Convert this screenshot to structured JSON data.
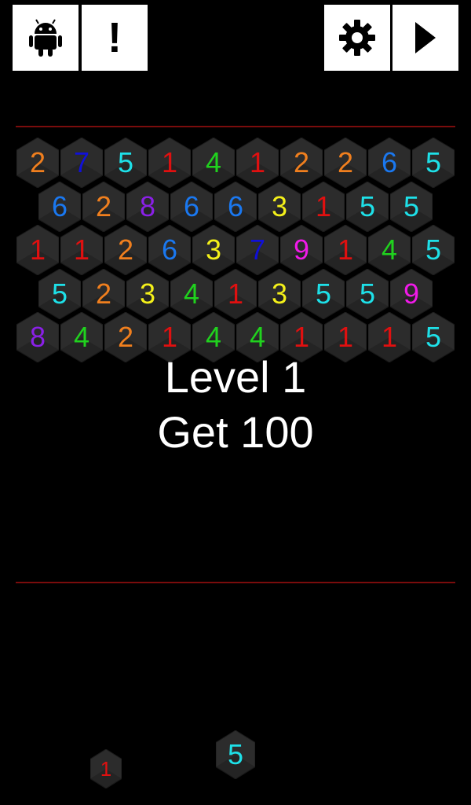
{
  "toolbar": {
    "android_icon": "android-icon",
    "info_label": "!",
    "settings_icon": "gear-icon",
    "play_icon": "play-icon"
  },
  "message": {
    "level": "Level 1",
    "goal": "Get 100"
  },
  "board": {
    "rows": [
      [
        2,
        7,
        5,
        1,
        4,
        1,
        2,
        2,
        6,
        5
      ],
      [
        6,
        2,
        8,
        6,
        6,
        3,
        1,
        5,
        5
      ],
      [
        1,
        1,
        2,
        6,
        3,
        7,
        9,
        1,
        4,
        5
      ],
      [
        5,
        2,
        3,
        4,
        1,
        3,
        5,
        5,
        9
      ],
      [
        8,
        4,
        2,
        1,
        4,
        4,
        1,
        1,
        1,
        5
      ]
    ]
  },
  "tray": [
    1,
    5
  ],
  "colors": {
    "1": "#e01010",
    "2": "#f07f1e",
    "3": "#f4f01a",
    "4": "#20d21e",
    "5": "#1ee0e8",
    "6": "#1a78f0",
    "7": "#1010d8",
    "8": "#8a20e6",
    "9": "#f01ae8",
    "tile": "#2c2c2c",
    "tile_edge": "#1b1b1b",
    "divider": "#7a0c0c",
    "background": "#000000"
  }
}
